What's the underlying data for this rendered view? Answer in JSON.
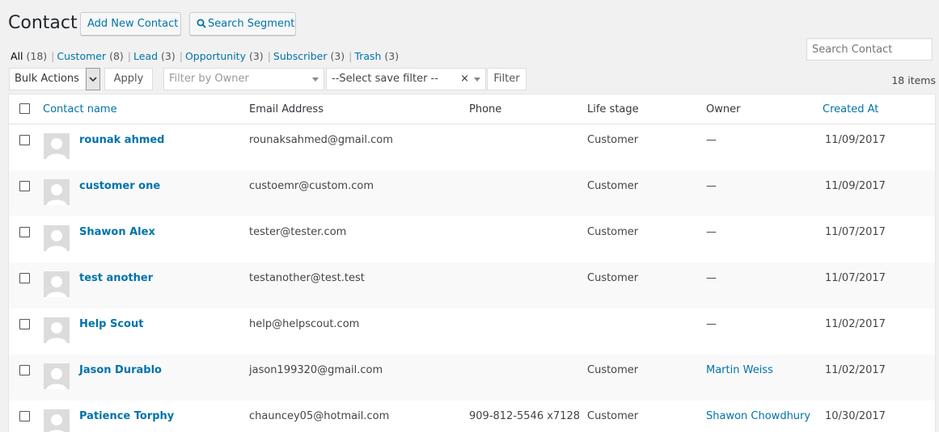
{
  "header": {
    "title": "Contact",
    "add_button": "Add New Contact",
    "search_segment_button": "Search Segment",
    "search_placeholder": "Search Contact"
  },
  "views": [
    {
      "label": "All",
      "count": "(18)"
    },
    {
      "label": "Customer",
      "count": "(8)"
    },
    {
      "label": "Lead",
      "count": "(3)"
    },
    {
      "label": "Opportunity",
      "count": "(3)"
    },
    {
      "label": "Subscriber",
      "count": "(3)"
    },
    {
      "label": "Trash",
      "count": "(3)"
    }
  ],
  "toolbar": {
    "bulk_actions": "Bulk Actions",
    "apply": "Apply",
    "owner_placeholder": "Filter by Owner",
    "save_filter": "--Select save filter --",
    "clear": "×",
    "filter": "Filter",
    "items_count": "18 items"
  },
  "table": {
    "columns": {
      "name": "Contact name",
      "email": "Email Address",
      "phone": "Phone",
      "stage": "Life stage",
      "owner": "Owner",
      "created": "Created At"
    },
    "rows": [
      {
        "name": "rounak ahmed",
        "email": "rounaksahmed@gmail.com",
        "phone": "",
        "stage": "Customer",
        "owner": "—",
        "created": "11/09/2017"
      },
      {
        "name": "customer one",
        "email": "custoemr@custom.com",
        "phone": "",
        "stage": "Customer",
        "owner": "—",
        "created": "11/09/2017"
      },
      {
        "name": "Shawon Alex",
        "email": "tester@tester.com",
        "phone": "",
        "stage": "Customer",
        "owner": "—",
        "created": "11/07/2017"
      },
      {
        "name": "test another",
        "email": "testanother@test.test",
        "phone": "",
        "stage": "Customer",
        "owner": "—",
        "created": "11/07/2017"
      },
      {
        "name": "Help Scout",
        "email": "help@helpscout.com",
        "phone": "",
        "stage": "",
        "owner": "—",
        "created": "11/02/2017"
      },
      {
        "name": "Jason Durablo",
        "email": "jason199320@gmail.com",
        "phone": "",
        "stage": "Customer",
        "owner": "Martin Weiss",
        "created": "11/02/2017"
      },
      {
        "name": "Patience Torphy",
        "email": "chauncey05@hotmail.com",
        "phone": "909-812-5546 x7128",
        "stage": "Customer",
        "owner": "Shawon Chowdhury",
        "created": "10/30/2017"
      }
    ]
  }
}
